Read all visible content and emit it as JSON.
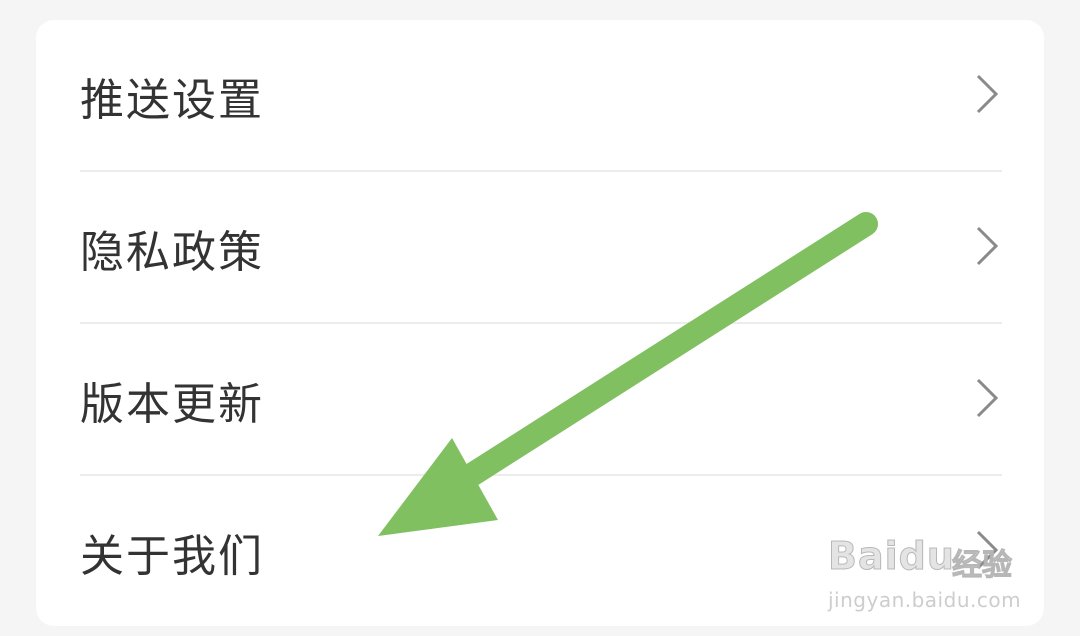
{
  "settings_menu": {
    "items": [
      {
        "label": "推送设置",
        "icon": "chevron-right-icon"
      },
      {
        "label": "隐私政策",
        "icon": "chevron-right-icon"
      },
      {
        "label": "版本更新",
        "icon": "chevron-right-icon"
      },
      {
        "label": "关于我们",
        "icon": "chevron-right-icon"
      }
    ]
  },
  "annotation": {
    "arrow_color": "#80c060",
    "points_to": "关于我们"
  },
  "watermark": {
    "logo": "Baidu",
    "logo_suffix": "经验",
    "url": "jingyan.baidu.com"
  }
}
